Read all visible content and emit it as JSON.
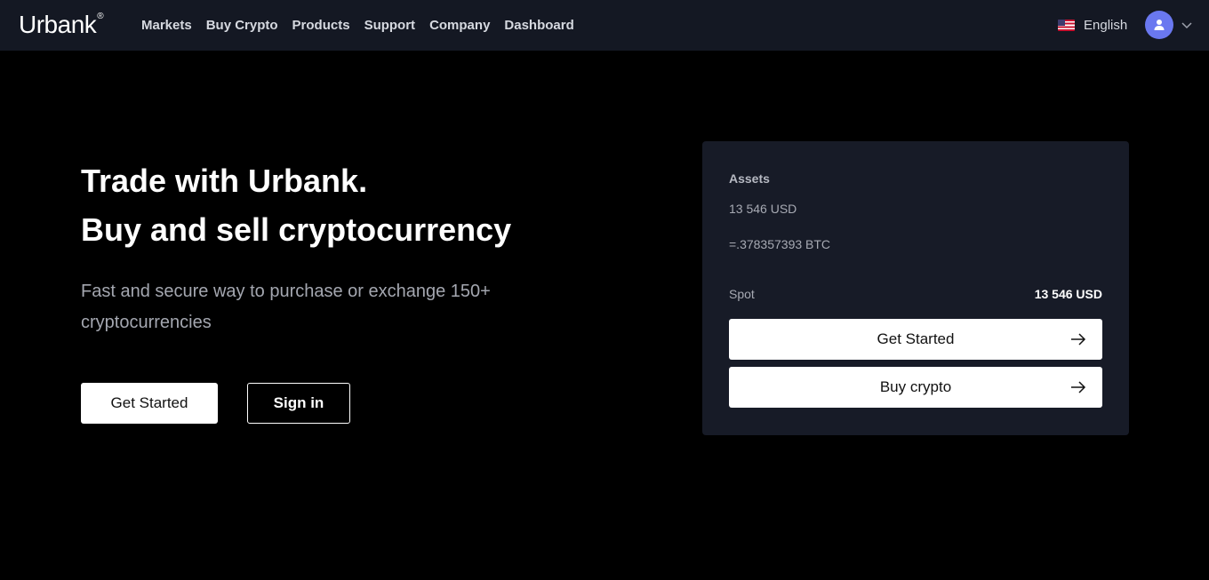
{
  "header": {
    "logo": "Urbank",
    "logo_mark": "®",
    "nav": [
      "Markets",
      "Buy Crypto",
      "Products",
      "Support",
      "Company",
      "Dashboard"
    ],
    "language": "English",
    "flag_icon": "us-flag-icon",
    "avatar_icon": "user-icon",
    "chevron_icon": "chevron-down-icon"
  },
  "hero": {
    "title_line1": "Trade with Urbank.",
    "title_line2": "Buy and sell cryptocurrency",
    "subtitle": "Fast and secure way to purchase or exchange 150+ cryptocurrencies",
    "primary_button": "Get Started",
    "secondary_button": "Sign in"
  },
  "card": {
    "assets_label": "Assets",
    "assets_usd": "13 546 USD",
    "assets_btc": "=.378357393 BTC",
    "spot_label": "Spot",
    "spot_value": "13 546 USD",
    "button1": "Get Started",
    "button2": "Buy crypto",
    "arrow_icon": "arrow-right-icon"
  },
  "colors": {
    "background": "#000000",
    "header_bg": "#141823",
    "card_bg": "#171b27",
    "avatar": "#6a78f0"
  }
}
